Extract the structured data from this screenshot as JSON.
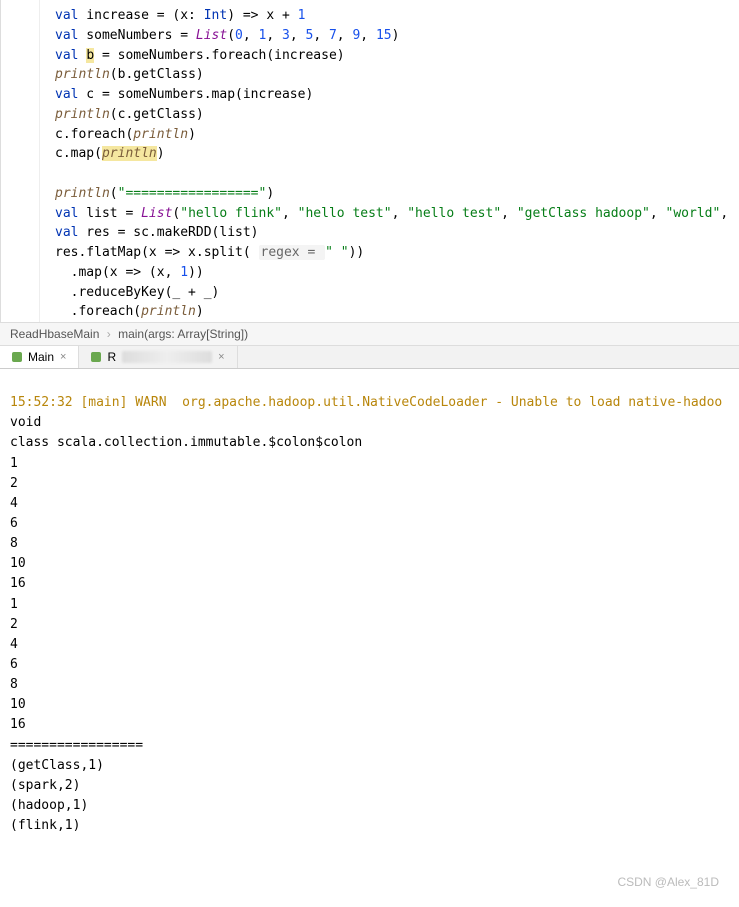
{
  "code": {
    "l1": "val increase = (x: Int) => x + 1",
    "l2": "val someNumbers = List(0, 1, 3, 5, 7, 9, 15)",
    "l3": "val b = someNumbers.foreach(increase)",
    "l4": "println(b.getClass)",
    "l5": "val c = someNumbers.map(increase)",
    "l6": "println(c.getClass)",
    "l7": "c.foreach(println)",
    "l8": "c.map(println)",
    "l9": "",
    "l10": "println(\"=================\")",
    "l11": "val list = List(\"hello flink\", \"hello test\", \"hello test\", \"getClass hadoop\", \"world\",",
    "l12": "val res = sc.makeRDD(list)",
    "l13": "res.flatMap(x => x.split( regex = \" \"))",
    "l14": "  .map(x => (x, 1))",
    "l15": "  .reduceByKey(_ + _)",
    "l16": "  .foreach(println)"
  },
  "tokens": {
    "val": "val",
    "increase": "increase",
    "int": "Int",
    "one": "1",
    "someNumbers": "someNumbers",
    "List": "List",
    "nums": {
      "n0": "0",
      "n1": "1",
      "n3": "3",
      "n5": "5",
      "n7": "7",
      "n9": "9",
      "n15": "15"
    },
    "b": "b",
    "foreach": "foreach",
    "println": "println",
    "getClass": "getClass",
    "c": "c",
    "map": "map",
    "sep_str": "\"=================\"",
    "list": "list",
    "strs": {
      "s1": "\"hello flink\"",
      "s2": "\"hello test\"",
      "s3": "\"hello test\"",
      "s4": "\"getClass hadoop\"",
      "s5": "\"world\""
    },
    "res": "res",
    "sc": "sc",
    "makeRDD": "makeRDD",
    "flatMap": "flatMap",
    "split": "split",
    "regex_label": "regex = ",
    "space_str": "\" \"",
    "reduceByKey": "reduceByKey"
  },
  "breadcrumb": {
    "class": "ReadHbaseMain",
    "method": "main(args: Array[String])"
  },
  "tabs": {
    "t1": "Main",
    "t2": "R"
  },
  "console": {
    "warn": "15:52:32 [main] WARN  org.apache.hadoop.util.NativeCodeLoader - Unable to load native-hadoo",
    "lines": [
      "void",
      "class scala.collection.immutable.$colon$colon",
      "1",
      "2",
      "4",
      "6",
      "8",
      "10",
      "16",
      "1",
      "2",
      "4",
      "6",
      "8",
      "10",
      "16",
      "=================",
      "(getClass,1)",
      "(spark,2)",
      "(hadoop,1)",
      "(flink,1)"
    ]
  },
  "watermark": "CSDN @Alex_81D"
}
